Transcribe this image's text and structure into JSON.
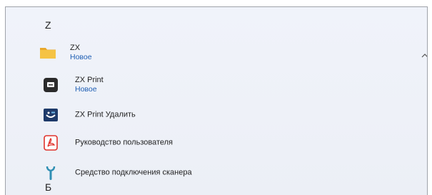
{
  "group_z": {
    "letter": "Z"
  },
  "folder": {
    "name": "ZX",
    "badge": "Новое",
    "icon": "folder-icon",
    "expanded_indicator": "chevron-up-icon"
  },
  "apps": [
    {
      "name": "ZX Print",
      "badge": "Новое",
      "icon": "printer-app-icon"
    },
    {
      "name": "ZX Print Удалить",
      "icon": "uninstall-app-icon"
    },
    {
      "name": "Руководство пользователя",
      "icon": "pdf-icon"
    },
    {
      "name": "Средство подключения сканера",
      "icon": "scanner-tool-icon"
    }
  ],
  "group_b": {
    "letter": "Б"
  },
  "colors": {
    "new_badge": "#1f5fb4",
    "folder": "#f5c344",
    "pdf": "#e0322c",
    "tool": "#2f8fb3"
  }
}
